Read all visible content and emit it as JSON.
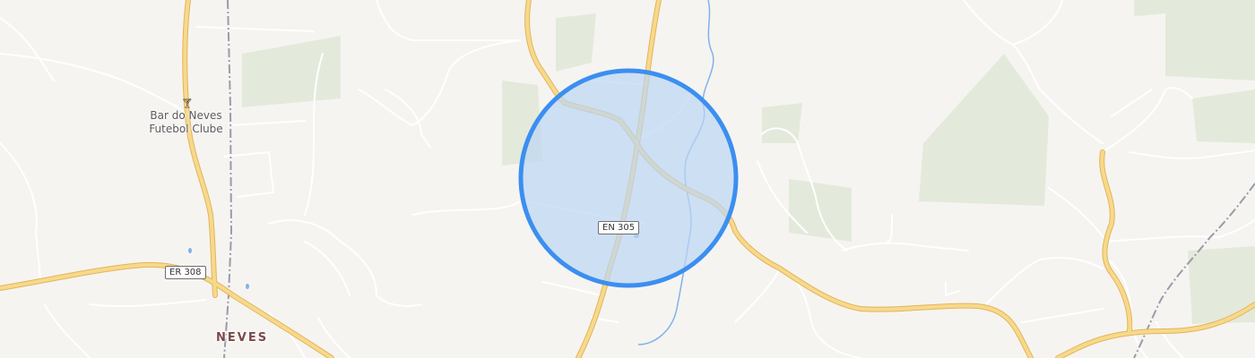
{
  "map": {
    "colors": {
      "background": "#f6f4f1",
      "green_area": "#e3eadb",
      "minor_road": "#ffffff",
      "major_road": "#f7d98b",
      "major_road_casing": "#e2b55b",
      "railway": "#9b9ba8",
      "water": "#7fb2ea",
      "location_circle_fill": "#bcd5f4",
      "location_circle_stroke": "#3b8ff0"
    },
    "labels": {
      "poi_name": "Bar do Neves\nFutebol Clube",
      "place_name": "NEVES"
    },
    "road_shields": {
      "en305": "EN 305",
      "er308": "ER 308"
    },
    "icons": {
      "bar": "cocktail-glass-icon",
      "location": "location-accuracy-circle"
    }
  }
}
